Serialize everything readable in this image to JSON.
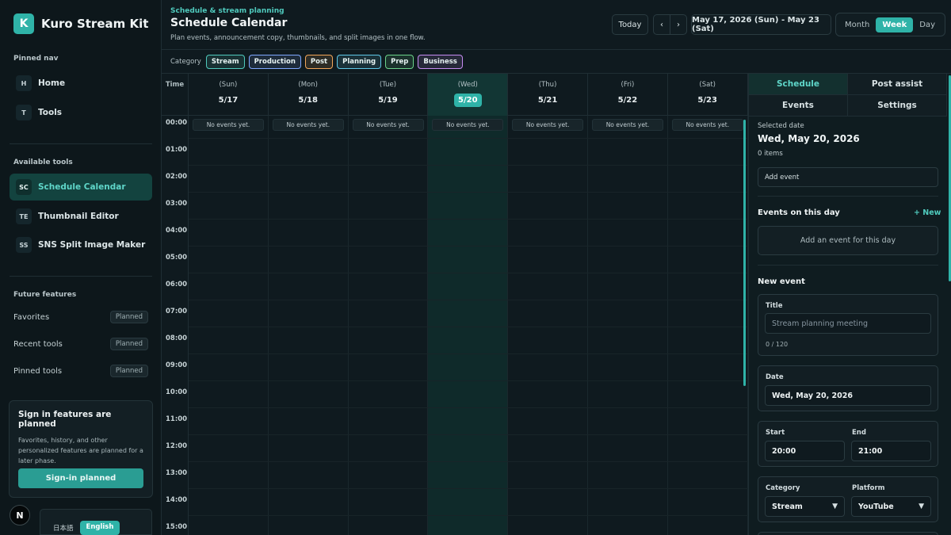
{
  "brand": {
    "logo_letter": "K",
    "name": "Kuro Stream Kit"
  },
  "sidebar": {
    "pinned_title": "Pinned nav",
    "pinned": [
      {
        "badge": "H",
        "label": "Home"
      },
      {
        "badge": "T",
        "label": "Tools"
      }
    ],
    "tools_title": "Available tools",
    "tools": [
      {
        "badge": "SC",
        "label": "Schedule Calendar",
        "active": true
      },
      {
        "badge": "TE",
        "label": "Thumbnail Editor"
      },
      {
        "badge": "SS",
        "label": "SNS Split Image Maker"
      }
    ],
    "future_title": "Future features",
    "future": [
      {
        "label": "Favorites",
        "status": "Planned"
      },
      {
        "label": "Recent tools",
        "status": "Planned"
      },
      {
        "label": "Pinned tools",
        "status": "Planned"
      }
    ],
    "signin": {
      "title": "Sign in features are planned",
      "desc": "Favorites, history, and other personalized features are planned for a later phase.",
      "button": "Sign-in planned"
    },
    "n_badge": "N",
    "lang": {
      "ja": "日本語",
      "en": "English"
    }
  },
  "header": {
    "eyebrow": "Schedule & stream planning",
    "title": "Schedule Calendar",
    "subtitle": "Plan events, announcement copy, thumbnails, and split images in one flow.",
    "today": "Today",
    "prev": "‹",
    "next": "›",
    "range": "May 17, 2026 (Sun) - May 23 (Sat)",
    "views": {
      "month": "Month",
      "week": "Week",
      "day": "Day"
    }
  },
  "categories": {
    "label": "Category",
    "items": [
      {
        "label": "Stream",
        "color": "#4fcabd"
      },
      {
        "label": "Production",
        "color": "#7fa8ff"
      },
      {
        "label": "Post",
        "color": "#f2a65a"
      },
      {
        "label": "Planning",
        "color": "#5fc8e8"
      },
      {
        "label": "Prep",
        "color": "#6bd38a"
      },
      {
        "label": "Business",
        "color": "#c58cf2"
      }
    ]
  },
  "calendar": {
    "time_label": "Time",
    "days": [
      {
        "dow": "(Sun)",
        "date": "5/17",
        "empty": "No events yet."
      },
      {
        "dow": "(Mon)",
        "date": "5/18",
        "empty": "No events yet."
      },
      {
        "dow": "(Tue)",
        "date": "5/19",
        "empty": "No events yet."
      },
      {
        "dow": "(Wed)",
        "date": "5/20",
        "empty": "No events yet.",
        "today": true
      },
      {
        "dow": "(Thu)",
        "date": "5/21",
        "empty": "No events yet."
      },
      {
        "dow": "(Fri)",
        "date": "5/22",
        "empty": "No events yet."
      },
      {
        "dow": "(Sat)",
        "date": "5/23",
        "empty": "No events yet."
      }
    ],
    "hours": [
      "00:00",
      "01:00",
      "02:00",
      "03:00",
      "04:00",
      "05:00",
      "06:00",
      "07:00",
      "08:00",
      "09:00",
      "10:00",
      "11:00",
      "12:00",
      "13:00",
      "14:00",
      "15:00"
    ]
  },
  "panel": {
    "tabs": {
      "schedule": "Schedule",
      "post_assist": "Post assist",
      "events": "Events",
      "settings": "Settings"
    },
    "selected_label": "Selected date",
    "selected_date": "Wed, May 20, 2026",
    "item_count": "0 items",
    "add_event": "Add event",
    "events_heading": "Events on this day",
    "new_link": "+ New",
    "empty_day": "Add an event for this day",
    "new_event_heading": "New event",
    "form": {
      "title_label": "Title",
      "title_placeholder": "Stream planning meeting",
      "title_counter": "0 / 120",
      "date_label": "Date",
      "date_value": "Wed, May 20, 2026",
      "start_label": "Start",
      "start_value": "20:00",
      "end_label": "End",
      "end_value": "21:00",
      "category_label": "Category",
      "category_value": "Stream",
      "platform_label": "Platform",
      "platform_value": "YouTube"
    }
  }
}
